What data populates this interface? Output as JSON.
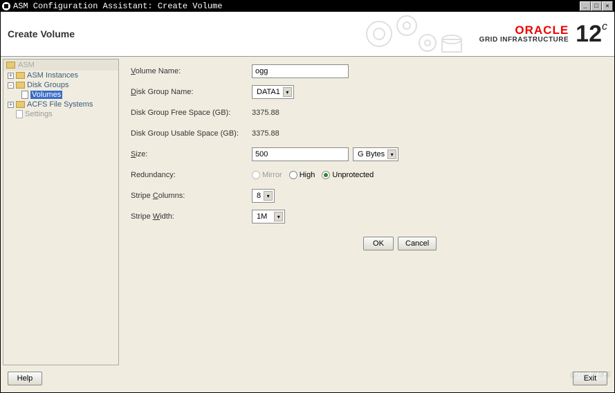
{
  "window": {
    "title": "ASM Configuration Assistant: Create Volume"
  },
  "header": {
    "heading": "Create Volume",
    "brand": "ORACLE",
    "subbrand": "GRID INFRASTRUCTURE",
    "version": "12",
    "version_sup": "c"
  },
  "sidebar": {
    "root": "ASM",
    "items": [
      {
        "label": "ASM Instances",
        "expandable": true
      },
      {
        "label": "Disk Groups",
        "expandable": true
      },
      {
        "label": "Volumes",
        "selected": true,
        "child": true
      },
      {
        "label": "ACFS File Systems",
        "expandable": true
      },
      {
        "label": "Settings",
        "disabled": true
      }
    ]
  },
  "form": {
    "volume_name_label": "Volume Name:",
    "volume_name_value": "ogg",
    "disk_group_label": "Disk Group Name:",
    "disk_group_value": "DATA1",
    "free_space_label": "Disk Group Free Space (GB):",
    "free_space_value": "3375.88",
    "usable_space_label": "Disk Group Usable Space (GB):",
    "usable_space_value": "3375.88",
    "size_label": "Size:",
    "size_value": "500",
    "size_unit": "G Bytes",
    "redundancy_label": "Redundancy:",
    "redundancy": {
      "mirror": "Mirror",
      "high": "High",
      "unprotected": "Unprotected"
    },
    "stripe_columns_label": "Stripe Columns:",
    "stripe_columns_value": "8",
    "stripe_width_label": "Stripe Width:",
    "stripe_width_value": "1M"
  },
  "buttons": {
    "ok": "OK",
    "cancel": "Cancel",
    "help": "Help",
    "exit": "Exit"
  }
}
